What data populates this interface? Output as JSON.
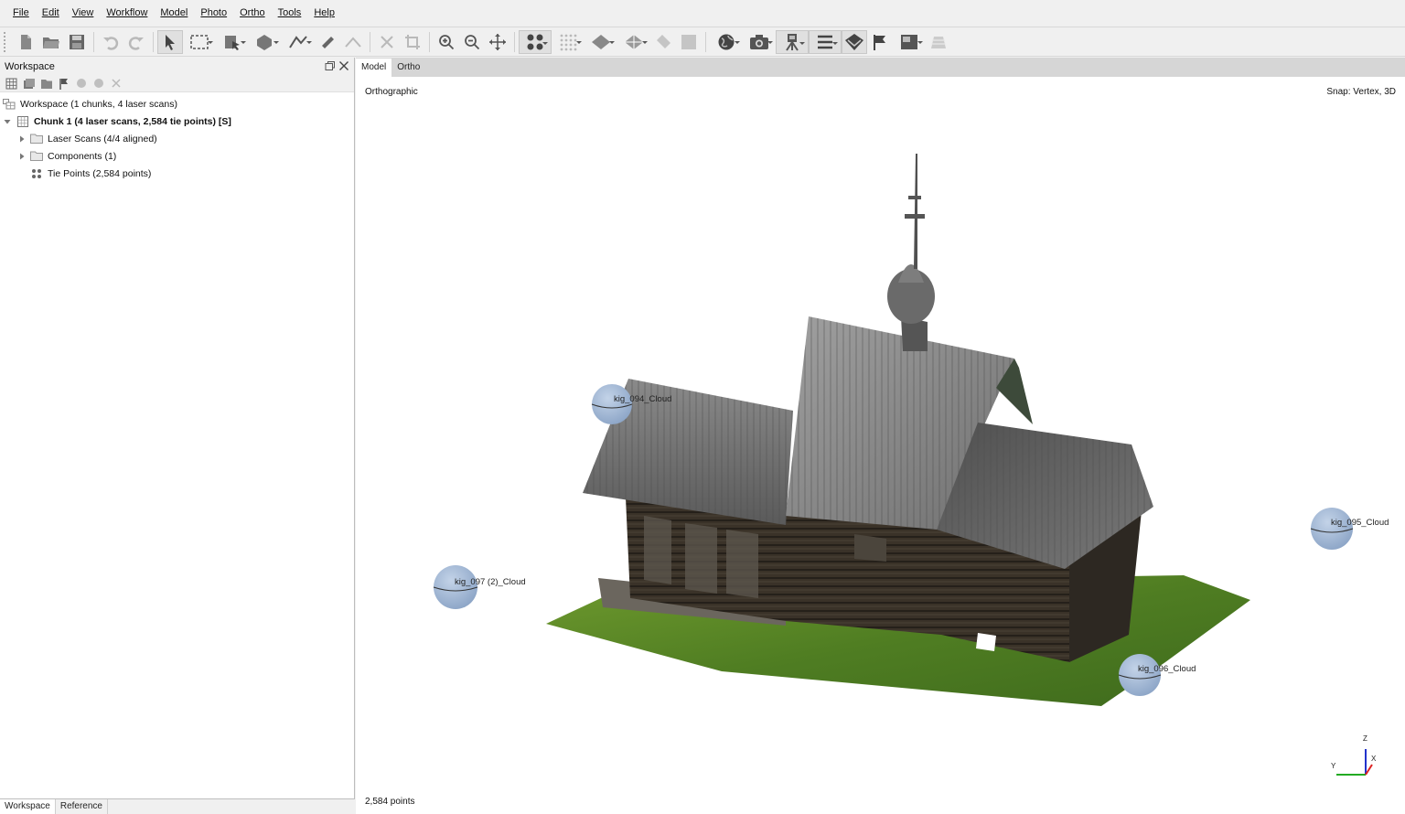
{
  "menubar": {
    "items": [
      {
        "label": "File",
        "name": "menu-file"
      },
      {
        "label": "Edit",
        "name": "menu-edit"
      },
      {
        "label": "View",
        "name": "menu-view"
      },
      {
        "label": "Workflow",
        "name": "menu-workflow"
      },
      {
        "label": "Model",
        "name": "menu-model"
      },
      {
        "label": "Photo",
        "name": "menu-photo"
      },
      {
        "label": "Ortho",
        "name": "menu-ortho"
      },
      {
        "label": "Tools",
        "name": "menu-tools"
      },
      {
        "label": "Help",
        "name": "menu-help"
      }
    ]
  },
  "workspace_panel": {
    "title": "Workspace",
    "tree": {
      "root": "Workspace (1 chunks, 4 laser scans)",
      "chunk": "Chunk 1 (4 laser scans, 2,584 tie points) [S]",
      "laser_scans": "Laser Scans (4/4 aligned)",
      "components": "Components (1)",
      "tie_points": "Tie Points (2,584 points)"
    }
  },
  "bottom_tabs": {
    "workspace": "Workspace",
    "reference": "Reference"
  },
  "view_tabs": {
    "model": "Model",
    "ortho": "Ortho"
  },
  "viewport": {
    "projection": "Orthographic",
    "snap": "Snap: Vertex, 3D",
    "point_count": "2,584 points",
    "scans": {
      "s094": "kig_094_Cloud",
      "s095": "kig_095_Cloud",
      "s096": "kig_096_Cloud",
      "s097": "kig_097 (2)_Cloud"
    },
    "axes": {
      "x": "X",
      "y": "Y",
      "z": "Z"
    }
  }
}
